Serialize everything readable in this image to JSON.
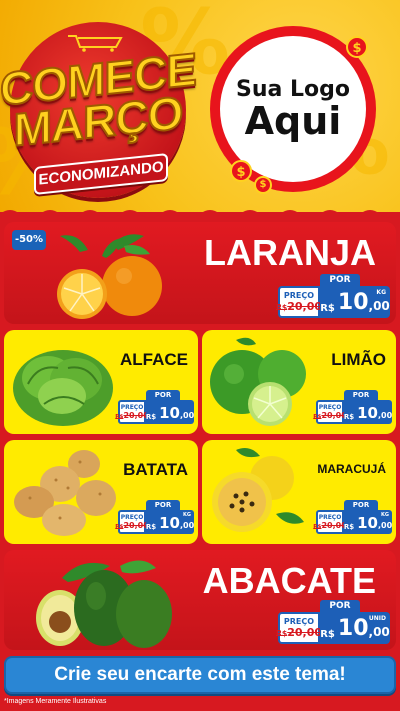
{
  "header": {
    "title_line1": "COMECE",
    "title_line2": "MARÇO",
    "tagline": "ECONOMIZANDO",
    "logo_line1": "Sua Logo",
    "logo_line2": "Aqui",
    "coin_symbol": "$",
    "bg_symbol": "%"
  },
  "products": {
    "laranja": {
      "name": "LARANJA",
      "discount": "-50%",
      "por": "POR",
      "preco": "PREÇO",
      "old_currency": "R$",
      "old_price": "20,00",
      "currency": "R$",
      "price": "10",
      "cents": ",00",
      "unit": "KG"
    },
    "alface": {
      "name": "ALFACE",
      "por": "POR",
      "preco": "PREÇO",
      "old_currency": "R$",
      "old_price": "20,00",
      "currency": "R$",
      "price": "10",
      "cents": ",00",
      "unit": ""
    },
    "limao": {
      "name": "LIMÃO",
      "por": "POR",
      "preco": "PREÇO",
      "old_currency": "R$",
      "old_price": "20,00",
      "currency": "R$",
      "price": "10",
      "cents": ",00",
      "unit": ""
    },
    "batata": {
      "name": "BATATA",
      "por": "POR",
      "preco": "PREÇO",
      "old_currency": "R$",
      "old_price": "20,00",
      "currency": "R$",
      "price": "10",
      "cents": ",00",
      "unit": "KG"
    },
    "maracuja": {
      "name": "MARACUJÁ",
      "por": "POR",
      "preco": "PREÇO",
      "old_currency": "R$",
      "old_price": "20,00",
      "currency": "R$",
      "price": "10",
      "cents": ",00",
      "unit": "KG"
    },
    "abacate": {
      "name": "ABACATE",
      "por": "POR",
      "preco": "PREÇO",
      "old_currency": "R$",
      "old_price": "20,00",
      "currency": "R$",
      "price": "10",
      "cents": ",00",
      "unit": "UNID"
    }
  },
  "cta": {
    "label": "Crie seu encarte com este tema!"
  },
  "footer": {
    "disclaimer": "*Imagens Meramente Ilustrativas"
  },
  "colors": {
    "brand_red": "#d71920",
    "brand_yellow": "#ffeb00",
    "price_blue": "#1d5fb7",
    "cta_blue": "#2a86d4"
  }
}
